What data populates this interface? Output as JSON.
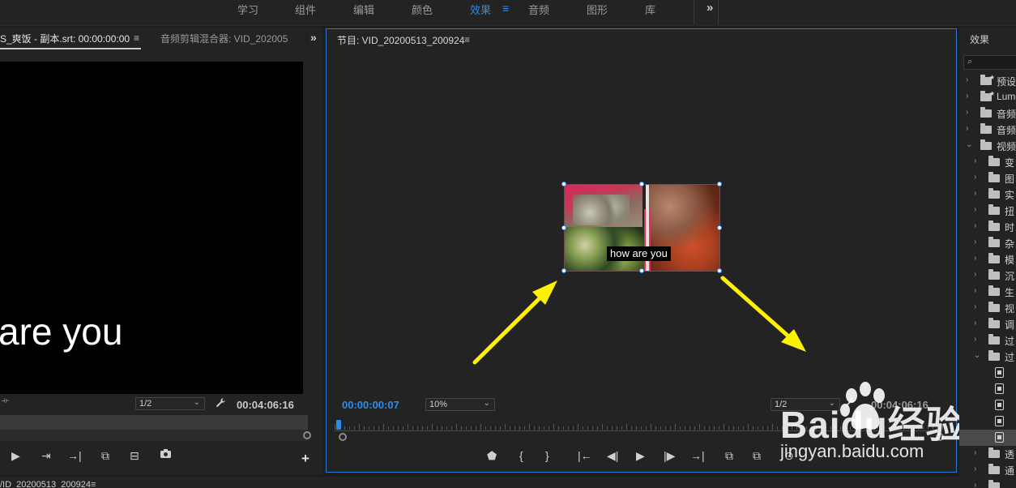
{
  "workspaces": {
    "tabs": [
      {
        "label": "学习",
        "active": false
      },
      {
        "label": "组件",
        "active": false
      },
      {
        "label": "编辑",
        "active": false
      },
      {
        "label": "颜色",
        "active": false
      },
      {
        "label": "效果",
        "active": true
      },
      {
        "label": "音频",
        "active": false
      },
      {
        "label": "图形",
        "active": false
      },
      {
        "label": "库",
        "active": false
      }
    ],
    "menu_icon": "≡",
    "more_icon": "»"
  },
  "source_panel": {
    "tab_label": "S_爽饭 - 副本.srt: 00:00:00:00",
    "menu_icon": "≡",
    "mixer_tab_label": "音频剪辑混合器: VID_202005",
    "expand_icon": "»",
    "caption_text": "are you",
    "resolution": "1/2",
    "timecode": "00:04:06:16",
    "wrench_icon": "wrench-icon"
  },
  "program_monitor": {
    "title": "节目: VID_20200513_200924",
    "menu_icon": "≡",
    "current_timecode": "00:00:00:07",
    "zoom": "10%",
    "resolution": "1/2",
    "duration": "00:04:06:16",
    "caption_text": "how are you"
  },
  "effects_panel": {
    "title": "效果",
    "search_icon": "⌕",
    "items": [
      {
        "label": "预设",
        "depth": 0,
        "icon": "preset-folder",
        "expanded": false
      },
      {
        "label": "Lumetri",
        "depth": 0,
        "icon": "preset-folder",
        "expanded": false
      },
      {
        "label": "音频",
        "depth": 0,
        "icon": "folder",
        "expanded": false
      },
      {
        "label": "音频",
        "depth": 0,
        "icon": "folder",
        "expanded": false
      },
      {
        "label": "视频",
        "depth": 0,
        "icon": "folder",
        "expanded": true
      },
      {
        "label": "变",
        "depth": 1,
        "icon": "folder",
        "expanded": false
      },
      {
        "label": "图",
        "depth": 1,
        "icon": "folder",
        "expanded": false
      },
      {
        "label": "实",
        "depth": 1,
        "icon": "folder",
        "expanded": false
      },
      {
        "label": "扭",
        "depth": 1,
        "icon": "folder",
        "expanded": false
      },
      {
        "label": "时",
        "depth": 1,
        "icon": "folder",
        "expanded": false
      },
      {
        "label": "杂",
        "depth": 1,
        "icon": "folder",
        "expanded": false
      },
      {
        "label": "模",
        "depth": 1,
        "icon": "folder",
        "expanded": false
      },
      {
        "label": "沉",
        "depth": 1,
        "icon": "folder",
        "expanded": false
      },
      {
        "label": "生",
        "depth": 1,
        "icon": "folder",
        "expanded": false
      },
      {
        "label": "视",
        "depth": 1,
        "icon": "folder",
        "expanded": false
      },
      {
        "label": "调",
        "depth": 1,
        "icon": "folder",
        "expanded": false
      },
      {
        "label": "过",
        "depth": 1,
        "icon": "folder",
        "expanded": false
      },
      {
        "label": "过",
        "depth": 1,
        "icon": "folder",
        "expanded": true
      },
      {
        "label": "",
        "depth": 2,
        "icon": "effect",
        "expanded": false
      },
      {
        "label": "",
        "depth": 2,
        "icon": "effect",
        "expanded": false
      },
      {
        "label": "",
        "depth": 2,
        "icon": "effect",
        "expanded": false
      },
      {
        "label": "",
        "depth": 2,
        "icon": "effect",
        "expanded": false
      },
      {
        "label": "",
        "depth": 2,
        "icon": "effect",
        "expanded": false,
        "selected": true
      },
      {
        "label": "透",
        "depth": 1,
        "icon": "folder",
        "expanded": false
      },
      {
        "label": "通",
        "depth": 1,
        "icon": "folder",
        "expanded": false
      },
      {
        "label": "",
        "depth": 1,
        "icon": "folder",
        "expanded": false
      }
    ]
  },
  "timeline": {
    "tab_label": "/ID_20200513_200924",
    "menu_icon": "≡"
  },
  "watermark": {
    "brand": "Baidu经验",
    "url": "jingyan.baidu.com"
  },
  "colors": {
    "accent": "#2d8ceb",
    "arrow": "#fff200",
    "panel_bg": "#232323"
  }
}
